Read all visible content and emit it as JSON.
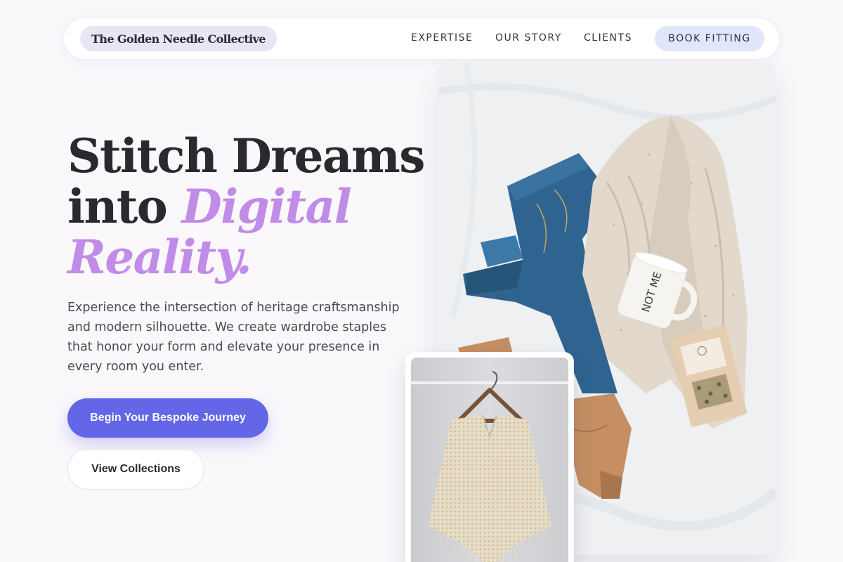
{
  "header": {
    "brand": "The Golden Needle Collective",
    "nav": {
      "expertise": "EXPERTISE",
      "our_story": "OUR STORY",
      "clients": "CLIENTS"
    },
    "cta": "BOOK FITTING"
  },
  "hero": {
    "headline": {
      "line1": "Stitch Dreams",
      "line2_plain": "into ",
      "line2_accent": "Digital",
      "line3_accent": "Reality."
    },
    "description": "Experience the intersection of heritage craftsmanship and modern silhouette. We create wardrobe staples that honor your form and elevate your presence in every room you enter.",
    "primary_button": "Begin Your Bespoke Journey",
    "secondary_button": "View Collections"
  },
  "images": {
    "main": {
      "mug_text": "NOT ME"
    }
  },
  "colors": {
    "accent_purple": "#c18be8",
    "primary_indigo": "#6366e6",
    "brand_chip": "#e9e6f4",
    "cta_chip": "#e2e6fa"
  }
}
